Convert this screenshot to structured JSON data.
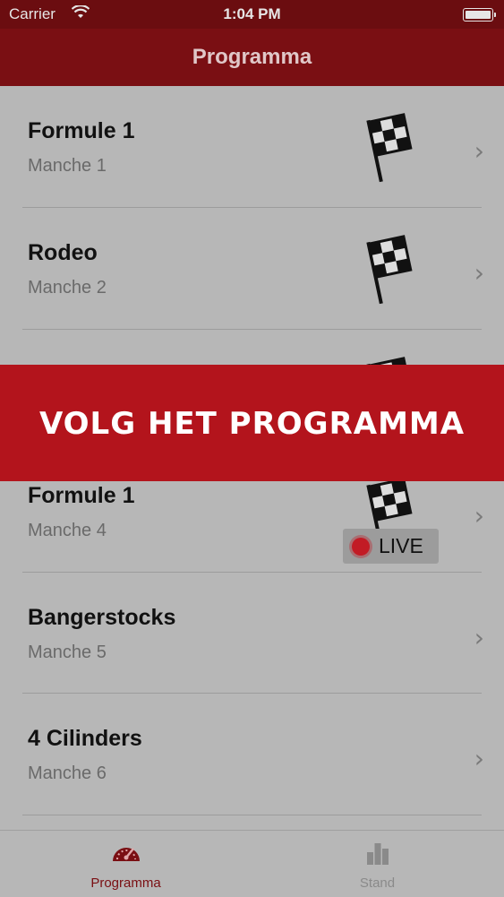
{
  "status_bar": {
    "carrier": "Carrier",
    "time": "1:04 PM"
  },
  "nav": {
    "title": "Programma"
  },
  "rows": [
    {
      "title": "Formule 1",
      "subtitle": "Manche 1",
      "icon": "checkered-flag-icon"
    },
    {
      "title": "Rodeo",
      "subtitle": "Manche 2",
      "icon": "checkered-flag-icon"
    },
    {
      "title": "",
      "subtitle": "",
      "icon": "checkered-flag-icon"
    },
    {
      "title": "Formule 1",
      "subtitle": "Manche 4",
      "icon": "checkered-flag-icon"
    },
    {
      "title": "Bangerstocks",
      "subtitle": "Manche 5",
      "badge": "LIVE"
    },
    {
      "title": "4 Cilinders",
      "subtitle": "Manche 6"
    }
  ],
  "banner": {
    "text": "VOLG HET PROGRAMMA"
  },
  "tabs": [
    {
      "label": "Programma",
      "icon": "speedometer-icon",
      "color": "#7a0f13"
    },
    {
      "label": "Stand",
      "icon": "bar-chart-icon",
      "color": "#8a8a8a"
    }
  ],
  "colors": {
    "accent": "#b3141c",
    "nav": "#7a0f13",
    "overlay_gray": "#b7b7b7"
  }
}
